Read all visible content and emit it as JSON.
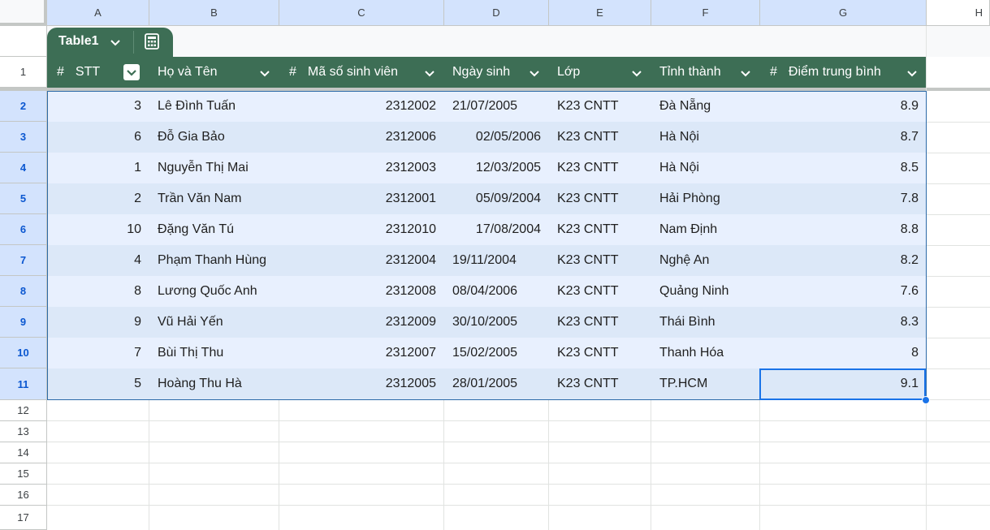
{
  "columns": [
    "A",
    "B",
    "C",
    "D",
    "E",
    "F",
    "G",
    "H"
  ],
  "table": {
    "name": "Table1",
    "headers": [
      "STT",
      "Họ và Tên",
      "Mã số sinh viên",
      "Ngày sinh",
      "Lớp",
      "Tỉnh thành",
      "Điểm trung bình"
    ],
    "rows": [
      [
        "3",
        "Lê Đình Tuấn",
        "2312002",
        "21/07/2005",
        "K23 CNTT",
        "Đà Nẵng",
        "8.9"
      ],
      [
        "6",
        "Đỗ Gia Bảo",
        "2312006",
        "02/05/2006",
        "K23 CNTT",
        "Hà Nội",
        "8.7"
      ],
      [
        "1",
        "Nguyễn Thị Mai",
        "2312003",
        "12/03/2005",
        "K23 CNTT",
        "Hà Nội",
        "8.5"
      ],
      [
        "2",
        "Trần Văn Nam",
        "2312001",
        "05/09/2004",
        "K23 CNTT",
        "Hải Phòng",
        "7.8"
      ],
      [
        "10",
        "Đặng Văn Tú",
        "2312010",
        "17/08/2004",
        "K23 CNTT",
        "Nam Định",
        "8.8"
      ],
      [
        "4",
        "Phạm Thanh Hùng",
        "2312004",
        "19/11/2004",
        "K23 CNTT",
        "Nghệ An",
        "8.2"
      ],
      [
        "8",
        "Lương Quốc Anh",
        "2312008",
        "08/04/2006",
        "K23 CNTT",
        "Quảng Ninh",
        "7.6"
      ],
      [
        "9",
        "Vũ Hải Yến",
        "2312009",
        "30/10/2005",
        "K23 CNTT",
        "Thái Bình",
        "8.3"
      ],
      [
        "7",
        "Bùi Thị Thu",
        "2312007",
        "15/02/2005",
        "K23 CNTT",
        "Thanh Hóa",
        "8"
      ],
      [
        "5",
        "Hoàng Thu Hà",
        "2312005",
        "28/01/2005",
        "K23 CNTT",
        "TP.HCM",
        "9.1"
      ]
    ]
  },
  "row_numbers": [
    "1",
    "2",
    "3",
    "4",
    "5",
    "6",
    "7",
    "8",
    "9",
    "10",
    "11",
    "12",
    "13",
    "14",
    "15",
    "16",
    "17"
  ],
  "colors": {
    "header_green": "#3d6e55",
    "row_light": "#e8f0fe",
    "row_dark": "#dce8f8",
    "selection": "#1a73e8"
  }
}
